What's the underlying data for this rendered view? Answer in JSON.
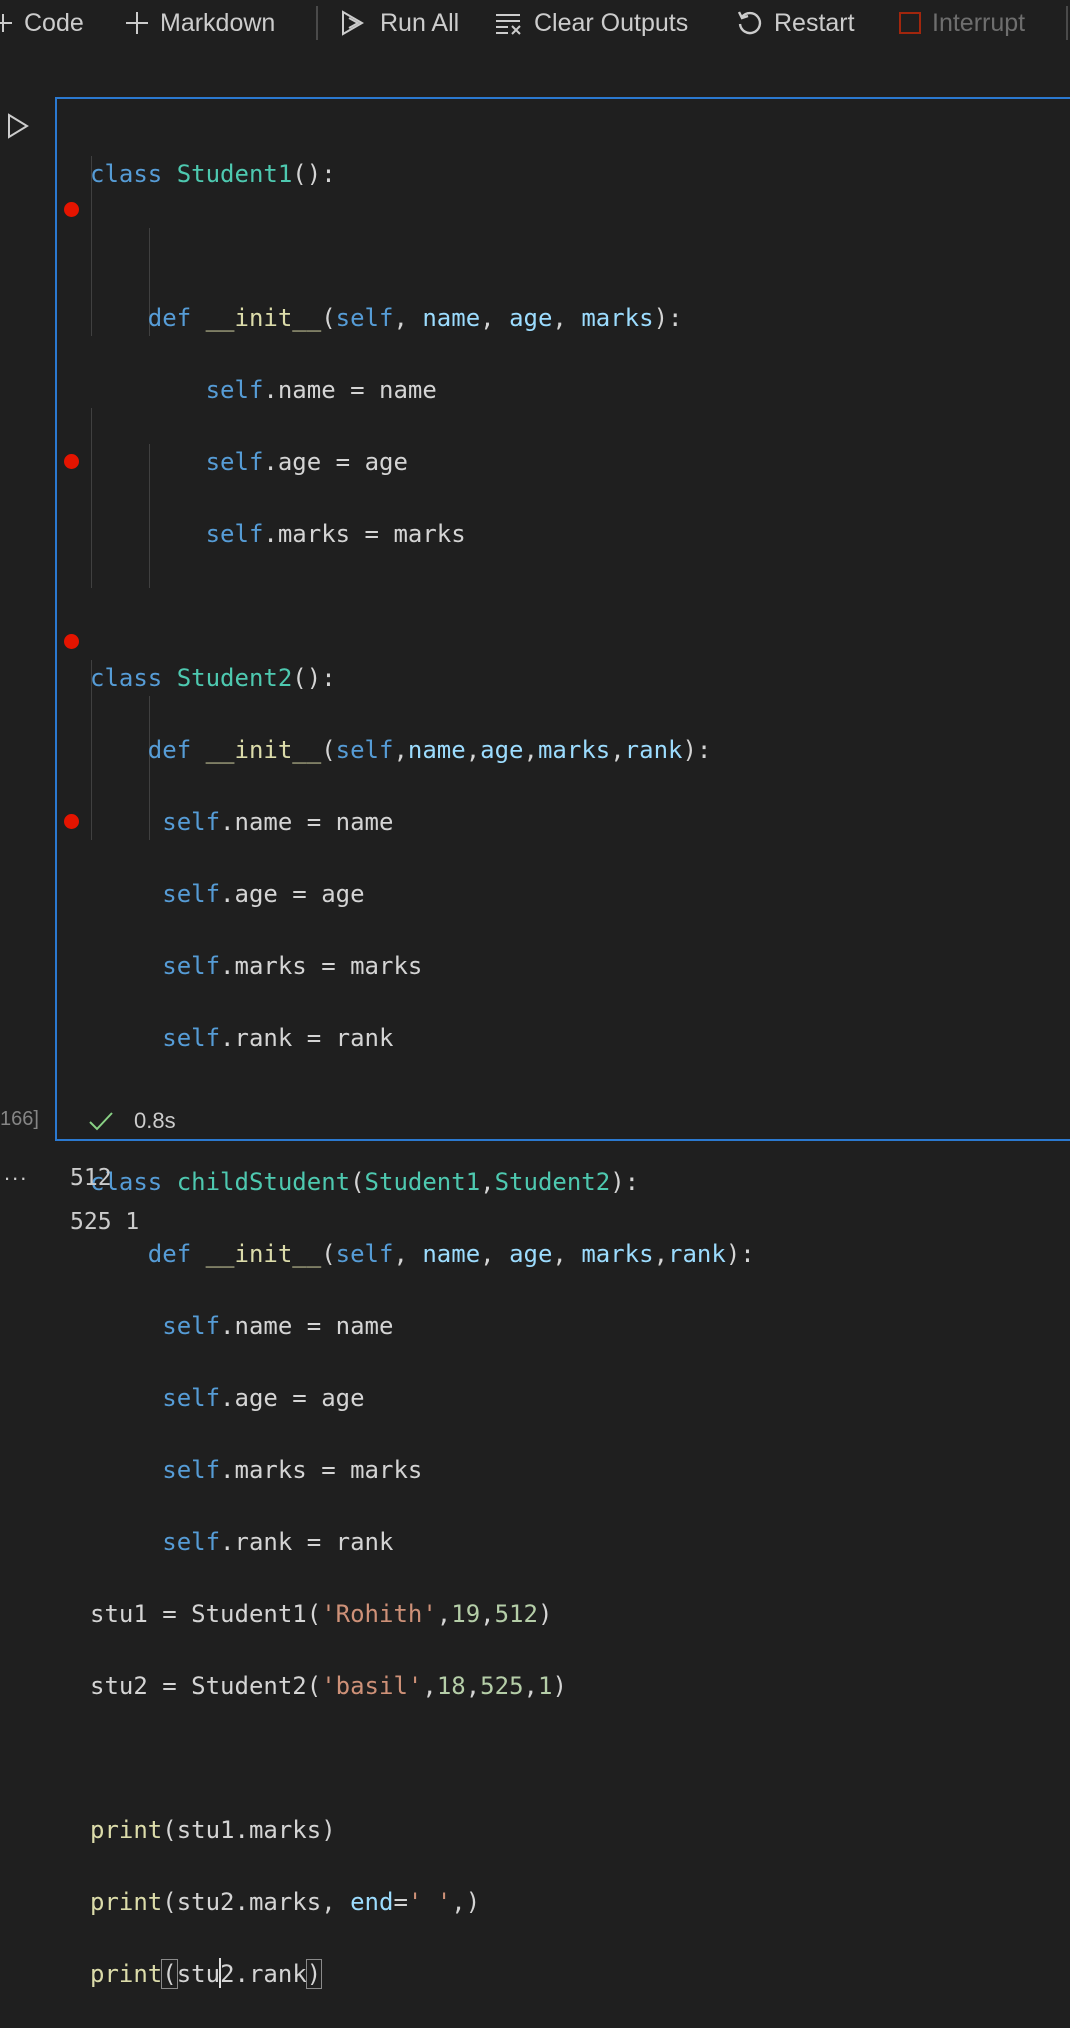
{
  "toolbar": {
    "code_label": "Code",
    "markdown_label": "Markdown",
    "run_all_label": "Run All",
    "clear_outputs_label": "Clear Outputs",
    "restart_label": "Restart",
    "interrupt_label": "Interrupt"
  },
  "cell": {
    "execution_count": "166]",
    "status_time": "0.8s",
    "output_lines": [
      "512",
      "525 1"
    ],
    "output_prefix": "..."
  },
  "code": {
    "t": {
      "class": "class",
      "def": "def",
      "self": "self",
      "print": "print",
      "end": "end",
      "init": "__init__",
      "Student1": "Student1",
      "Student2": "Student2",
      "childStudent": "childStudent",
      "name": "name",
      "age": "age",
      "marks": "marks",
      "rank": "rank",
      "stu1": "stu1",
      "stu2": "stu2",
      "rohith": "'Rohith'",
      "basil": "'basil'",
      "space_str": "' '",
      "n19": "19",
      "n512": "512",
      "n18": "18",
      "n525": "525",
      "n1": "1"
    }
  }
}
